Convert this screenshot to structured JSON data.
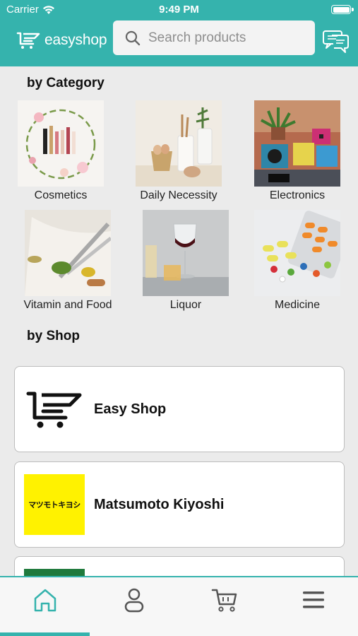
{
  "status_bar": {
    "carrier": "Carrier",
    "time": "9:49 PM"
  },
  "header": {
    "logo_text": "easyshop",
    "search_placeholder": "Search products",
    "chat_icon": "chat-bubbles-icon"
  },
  "colors": {
    "brand": "#35b3ad",
    "background": "#ebebeb",
    "kiyoshi_yellow": "#fff200"
  },
  "category_section": {
    "title": "by Category",
    "items": [
      {
        "label": "Cosmetics",
        "image": "cosmetics-photo"
      },
      {
        "label": "Daily Necessity",
        "image": "daily-necessity-photo"
      },
      {
        "label": "Electronics",
        "image": "electronics-photo"
      },
      {
        "label": "Vitamin and Food",
        "image": "vitamin-food-photo"
      },
      {
        "label": "Liquor",
        "image": "liquor-photo"
      },
      {
        "label": "Medicine",
        "image": "medicine-photo"
      }
    ]
  },
  "shop_section": {
    "title": "by Shop",
    "shops": [
      {
        "name": "Easy Shop",
        "logo": "easyshop-cart-logo"
      },
      {
        "name": "Matsumoto Kiyoshi",
        "logo": "matsukiyo-logo",
        "logo_text": "マツモトキヨシ"
      }
    ]
  },
  "tab_bar": {
    "tabs": [
      "home-icon",
      "profile-icon",
      "cart-icon",
      "menu-icon"
    ],
    "active": "home-icon"
  }
}
